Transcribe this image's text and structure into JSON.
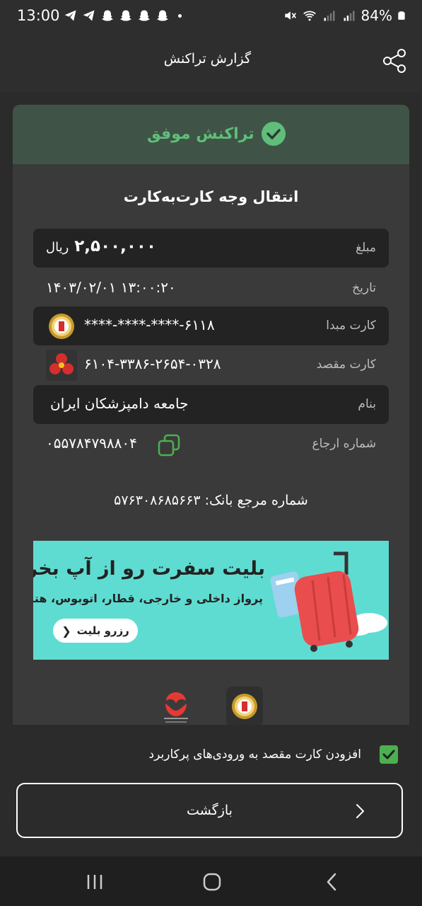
{
  "status_bar": {
    "time": "13:00",
    "battery": "84%"
  },
  "header": {
    "title": "گزارش تراکنش"
  },
  "receipt": {
    "status": "تراکنش موفق",
    "title": "انتقال وجه کارت‌به‌کارت",
    "amount": {
      "label": "مبلغ",
      "value": "۲,۵۰۰,۰۰۰",
      "unit": "ریال"
    },
    "date": {
      "label": "تاریخ",
      "value": "۱۳:۰۰:۲۰ ۱۴۰۳/۰۲/۰۱"
    },
    "source_card": {
      "label": "کارت مبدا",
      "value": "****-****-****-۶۱۱۸"
    },
    "dest_card": {
      "label": "کارت مقصد",
      "value": "۶۱۰۴-۳۳۸۶-۲۶۵۴-۰۳۲۸"
    },
    "name": {
      "label": "بنام",
      "value": "جامعه دامپزشکان ایران"
    },
    "reference": {
      "label": "شماره ارجاع",
      "value": "۰۵۵۷۸۴۷۹۸۸۰۴"
    },
    "bank_reference": "شماره مرجع بانک: ۵۷۶۳۰۸۶۸۵۶۶۳"
  },
  "ad": {
    "title": "بلیت سفرت رو از آپ بخر!",
    "subtitle": "پرواز داخلی و خارجی، قطار، اتوبوس، هتل",
    "button": "رزرو بلیت"
  },
  "options": {
    "add_card_label": "افزودن کارت مقصد به ورودی‌های پرکاربرد",
    "add_card_checked": true
  },
  "actions": {
    "back_label": "بازگشت"
  },
  "colors": {
    "success": "#5fbe7a",
    "success_band": "#3f5446",
    "checkbox": "#4caf50",
    "ad_background": "#5fdcd2"
  }
}
